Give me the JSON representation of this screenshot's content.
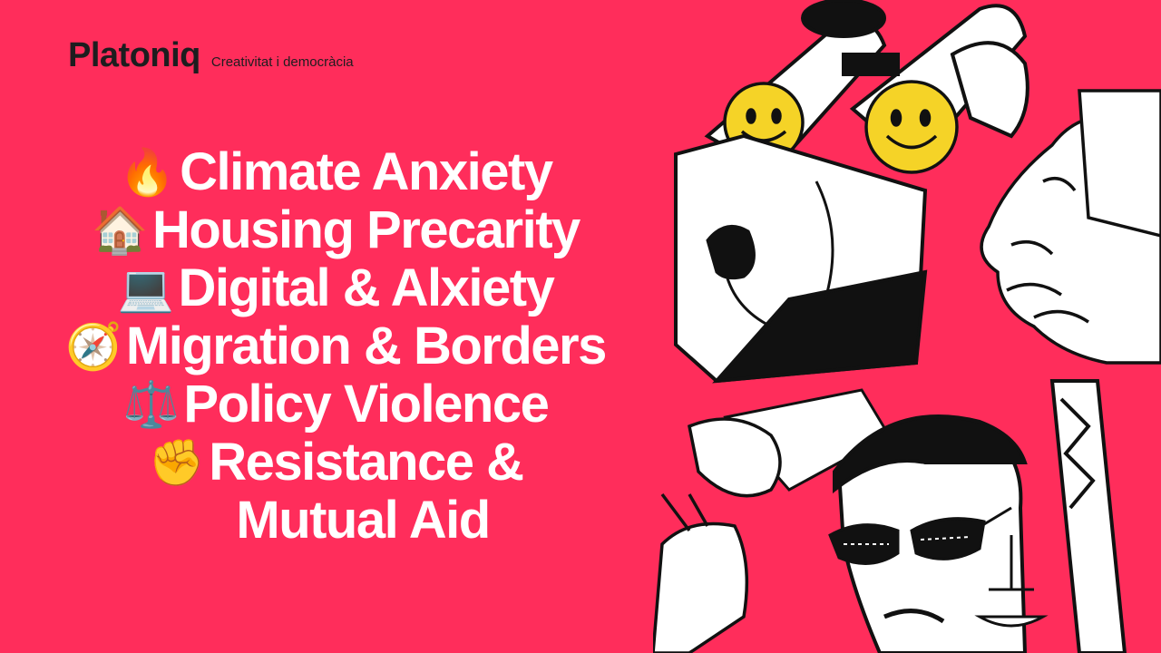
{
  "brand": {
    "name": "Platoniq",
    "tagline": "Creativitat i democràcia"
  },
  "topics": [
    {
      "emoji": "🔥",
      "label": "Climate Anxiety"
    },
    {
      "emoji": "🏠",
      "label": "Housing Precarity"
    },
    {
      "emoji": "💻",
      "label": "Digital & Alxiety"
    },
    {
      "emoji": "🧭",
      "label": "Migration & Borders"
    },
    {
      "emoji": "⚖️",
      "label": "Policy Violence"
    },
    {
      "emoji": "✊",
      "label": "Resistance &"
    },
    {
      "emoji": "",
      "label": "Mutual Aid"
    }
  ],
  "colors": {
    "background": "#ff2d5b",
    "text": "#ffffff",
    "brand_text": "#1d1d1f",
    "smiley": "#f5d327",
    "ink": "#111111"
  },
  "illustration_icons": [
    "smiley-face-icon",
    "binoculars-icon",
    "sunglasses-icon",
    "scales-earring-icon"
  ]
}
